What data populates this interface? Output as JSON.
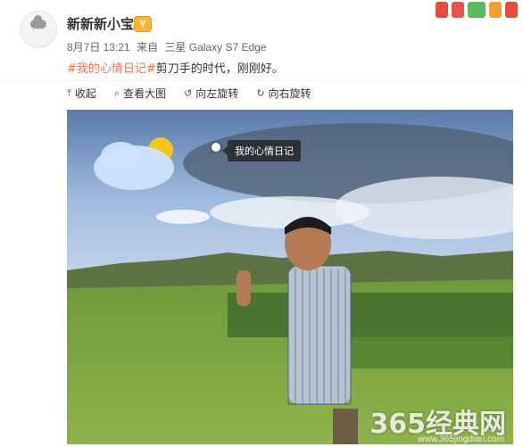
{
  "user": {
    "name": "新新新小宝",
    "vip_badge": "V"
  },
  "post": {
    "date": "8月7日 13:21",
    "source_prefix": "来自",
    "device": "三星 Galaxy S7 Edge",
    "topic": "#我的心情日记#",
    "text": "剪刀手的时代，刚刚好。"
  },
  "toolbar": {
    "collapse": "收起",
    "view_large": "查看大图",
    "rotate_left": "向左旋转",
    "rotate_right": "向右旋转"
  },
  "image": {
    "tag_label": "我的心情日记",
    "watermark": "365经典网",
    "watermark_url": "www.365jingdian.com"
  },
  "colors": {
    "topic": "#eb7350",
    "deco_1": "#e74c3c",
    "deco_2": "#3aa757",
    "deco_3": "#f39c12",
    "deco_4": "#e74c3c"
  }
}
